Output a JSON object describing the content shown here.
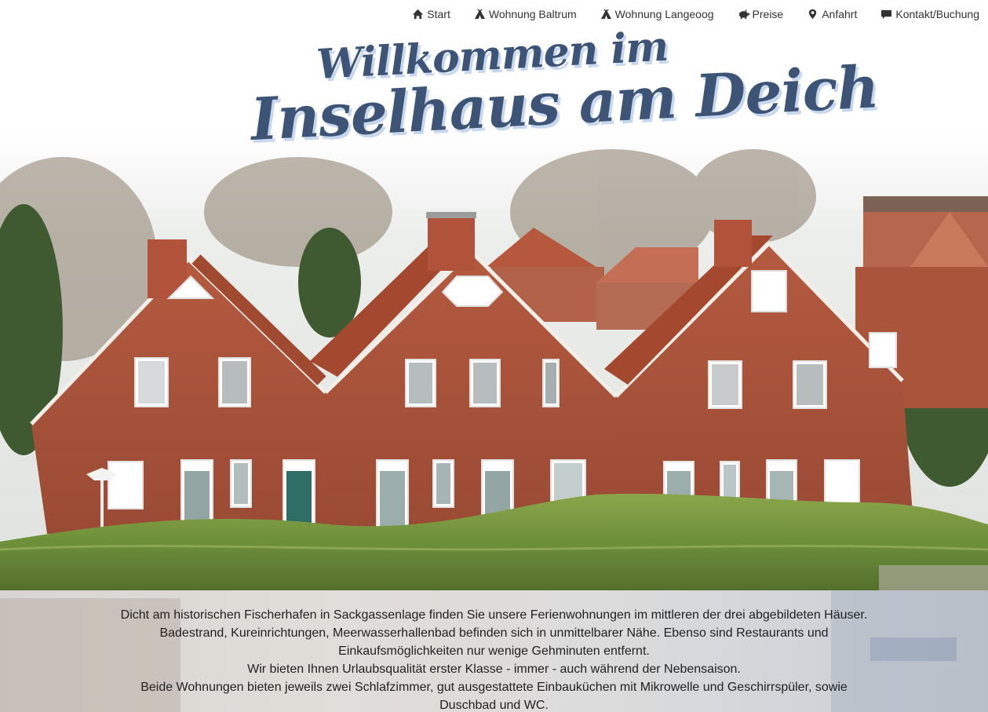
{
  "nav": {
    "items": [
      {
        "label": "Start",
        "icon": "home-icon"
      },
      {
        "label": "Wohnung Baltrum",
        "icon": "tent-icon"
      },
      {
        "label": "Wohnung Langeoog",
        "icon": "tent-icon"
      },
      {
        "label": "Preise",
        "icon": "piggy-bank-icon"
      },
      {
        "label": "Anfahrt",
        "icon": "map-marker-icon"
      },
      {
        "label": "Kontakt/Buchung",
        "icon": "comment-icon"
      }
    ]
  },
  "hero": {
    "title_line1": "Willkommen im",
    "title_line2": "Inselhaus am Deich"
  },
  "intro": {
    "paragraph1": "Dicht am historischen Fischerhafen in Sackgassenlage finden Sie unsere Ferienwohnungen im mittleren der drei abgebildeten Häuser. Badestrand, Kureinrichtungen, Meerwasserhallenbad befinden sich in unmittelbarer Nähe. Ebenso sind Restaurants und Einkaufsmöglichkeiten nur wenige Gehminuten entfernt.",
    "paragraph2": "Wir bieten Ihnen Urlaubsqualität erster Klasse - immer - auch während der Nebensaison.",
    "paragraph3": "Beide Wohnungen bieten jeweils zwei Schlafzimmer, gut ausgestattete Einbauküchen mit Mikrowelle und Geschirrspüler, sowie Duschbad und WC."
  },
  "colors": {
    "title": "#3e5477",
    "title_shadow": "#c7d7ee",
    "brick": "#a8553c",
    "roof": "#b8583c",
    "grass": "#6e8f3a"
  }
}
